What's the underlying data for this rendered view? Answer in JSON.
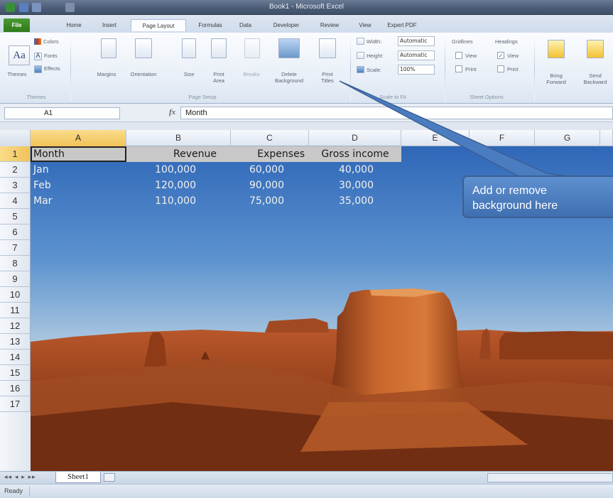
{
  "window": {
    "title": "Book1 - Microsoft Excel"
  },
  "tabs": [
    "File",
    "Home",
    "Insert",
    "Page Layout",
    "Formulas",
    "Data",
    "Developer",
    "Review",
    "View",
    "Expert PDF"
  ],
  "active_tab": "Page Layout",
  "ribbon": {
    "themes": {
      "themes": "Themes",
      "colors": "Colors",
      "fonts": "Fonts",
      "effects": "Effects",
      "group": "Themes"
    },
    "page_setup": {
      "margins": "Margins",
      "orientation": "Orientation",
      "size": "Size",
      "print_area_1": "Print",
      "print_area_2": "Area",
      "breaks": "Breaks",
      "background_1": "Delete",
      "background_2": "Background",
      "print_titles_1": "Print",
      "print_titles_2": "Titles",
      "group": "Page Setup"
    },
    "scale_to_fit": {
      "width_label": "Width:",
      "width_value": "Automatic",
      "height_label": "Height:",
      "height_value": "Automatic",
      "scale_label": "Scale:",
      "scale_value": "100%",
      "group": "Scale to Fit"
    },
    "sheet_options": {
      "gridlines": "Gridlines",
      "headings": "Headings",
      "view": "View",
      "print": "Print",
      "group": "Sheet Options"
    },
    "arrange": {
      "bring_1": "Bring",
      "bring_2": "Forward",
      "send_1": "Send",
      "send_2": "Backward"
    }
  },
  "formula_bar": {
    "name_box": "A1",
    "fx": "fx",
    "content": "Month"
  },
  "columns": [
    "A",
    "B",
    "C",
    "D",
    "E",
    "F",
    "G"
  ],
  "rows": [
    "1",
    "2",
    "3",
    "4",
    "5",
    "6",
    "7",
    "8",
    "9",
    "10",
    "11",
    "12",
    "13",
    "14",
    "15",
    "16",
    "17"
  ],
  "table": {
    "headers": [
      "Month",
      "Revenue",
      "Expenses",
      "Gross income"
    ],
    "rows": [
      [
        "Jan",
        "100,000",
        "60,000",
        "40,000"
      ],
      [
        "Feb",
        "120,000",
        "90,000",
        "30,000"
      ],
      [
        "Mar",
        "110,000",
        "75,000",
        "35,000"
      ]
    ]
  },
  "callout": {
    "line1": "Add or remove",
    "line2": "background here"
  },
  "sheet_tab": "Sheet1",
  "status": "Ready",
  "colors": {
    "selected_header": "#f1c25a",
    "file_tab": "#2f7a1a",
    "callout": "#4a7cc0"
  }
}
